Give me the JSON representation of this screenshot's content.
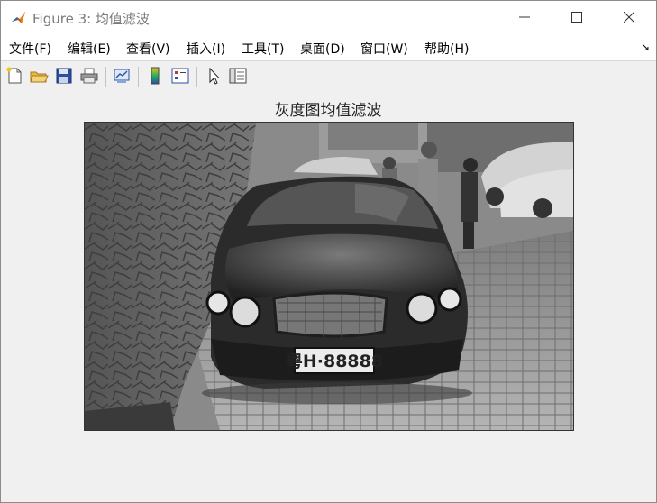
{
  "window": {
    "title": "Figure 3: 均值滤波"
  },
  "menu": {
    "items": [
      "文件(F)",
      "编辑(E)",
      "查看(V)",
      "插入(I)",
      "工具(T)",
      "桌面(D)",
      "窗口(W)",
      "帮助(H)"
    ],
    "overflow_icon": "dock-arrow-icon"
  },
  "toolbar": {
    "buttons": [
      "new-figure-icon",
      "open-file-icon",
      "save-icon",
      "print-icon",
      "link-plot-icon",
      "insert-colorbar-icon",
      "insert-legend-icon",
      "edit-plot-pointer-icon",
      "property-inspector-icon"
    ]
  },
  "axes": {
    "title": "灰度图均值滤波"
  },
  "photo": {
    "license_plate": "粤H·88888",
    "colors": {
      "bg": "#5a5a5a",
      "car": "#2a2a2a",
      "wall": "#6b6b6b",
      "ground": "#9a9a9a"
    }
  }
}
